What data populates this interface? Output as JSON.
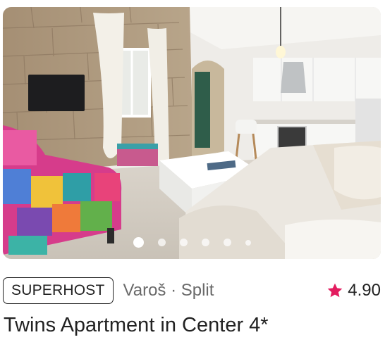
{
  "listing": {
    "badge": "SUPERHOST",
    "location": "Varoš · Split",
    "rating": "4.90",
    "title": "Twins Apartment in Center 4*"
  },
  "photo": {
    "alt": "Apartment living room with stone wall, colorful armchair, white coffee table and kitchen",
    "carousel": {
      "total_dots": 6,
      "active_index": 0
    }
  },
  "colors": {
    "star": "#e31c5f",
    "text_primary": "#222222",
    "text_secondary": "#6a6a6a"
  },
  "icons": {
    "rating": "star-icon"
  }
}
